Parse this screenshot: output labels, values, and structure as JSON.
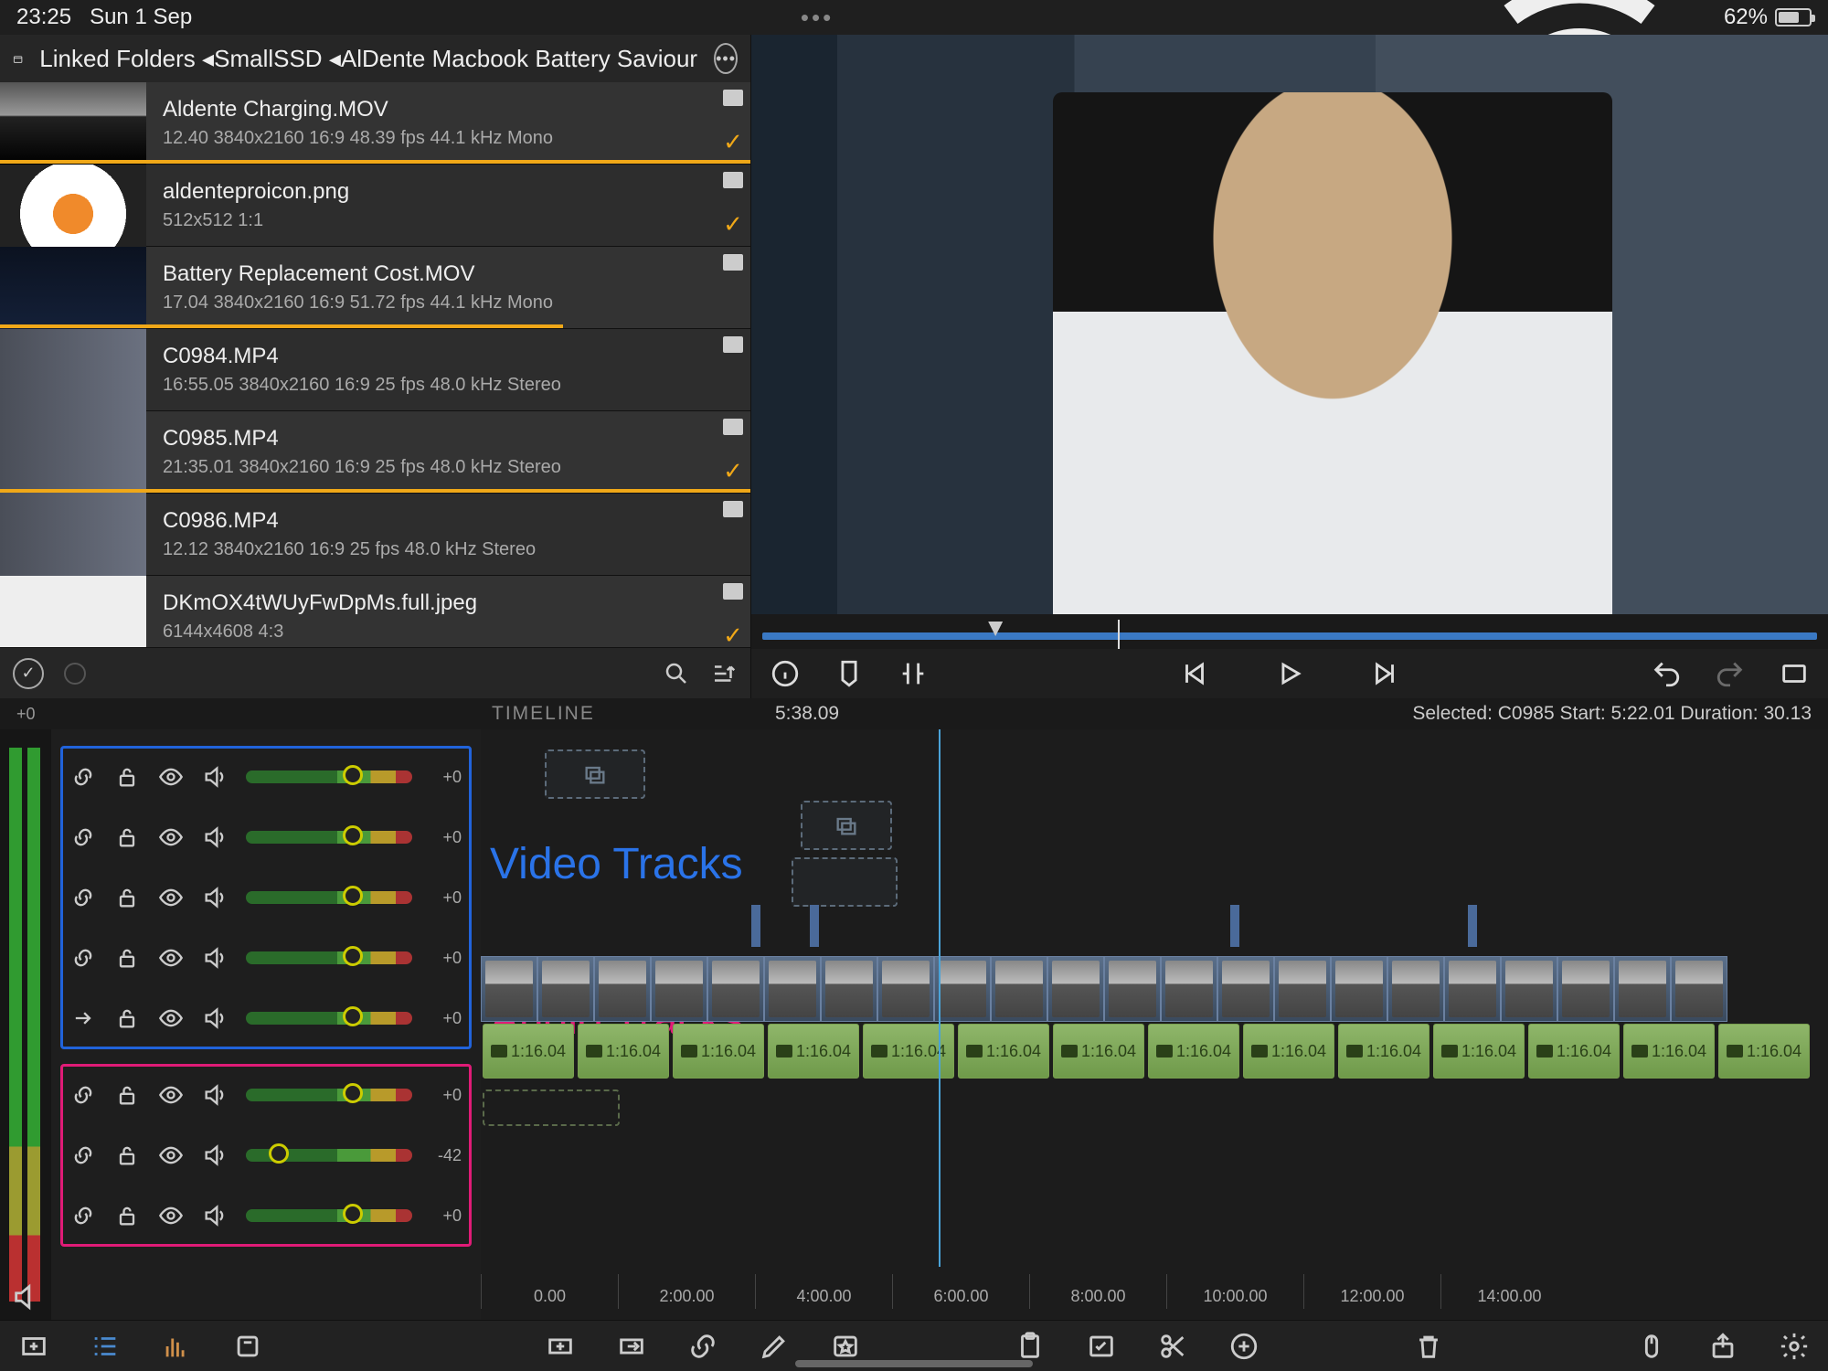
{
  "status": {
    "time": "23:25",
    "date": "Sun 1 Sep",
    "battery_pct": "62%"
  },
  "browser": {
    "breadcrumb_root": "Linked Folders",
    "breadcrumb_mid": "SmallSSD",
    "breadcrumb_leaf": "AlDente Macbook Battery Saviour",
    "items": [
      {
        "title": "Aldente Charging.MOV",
        "meta": "12.40  3840x2160  16:9  48.39 fps  44.1 kHz  Mono",
        "imported": true,
        "bar": 100,
        "thumb": "bw"
      },
      {
        "title": "aldenteproicon.png",
        "meta": "512x512  1:1",
        "imported": true,
        "bar": 0,
        "thumb": "food"
      },
      {
        "title": "Battery Replacement Cost.MOV",
        "meta": "17.04  3840x2160  16:9  51.72 fps  44.1 kHz  Mono",
        "imported": false,
        "bar": 75,
        "thumb": "dark"
      },
      {
        "title": "C0984.MP4",
        "meta": "16:55.05  3840x2160  16:9  25 fps  48.0 kHz  Stereo",
        "imported": false,
        "bar": 0,
        "thumb": "person"
      },
      {
        "title": "C0985.MP4",
        "meta": "21:35.01  3840x2160  16:9  25 fps  48.0 kHz  Stereo",
        "imported": true,
        "bar": 100,
        "thumb": "person"
      },
      {
        "title": "C0986.MP4",
        "meta": "12.12  3840x2160  16:9  25 fps  48.0 kHz  Stereo",
        "imported": false,
        "bar": 0,
        "thumb": "person"
      },
      {
        "title": "DKmOX4tWUyFwDpMs.full.jpeg",
        "meta": "6144x4608  4:3",
        "imported": true,
        "bar": 0,
        "thumb": "white"
      }
    ]
  },
  "timeline": {
    "label": "TIMELINE",
    "header_left": "+0",
    "playhead_time": "5:38.09",
    "selection": "Selected: C0985 Start: 5:22.01 Duration: 30.13",
    "video_label": "Video Tracks",
    "audio_label": "Audio Tracks",
    "video_tracks": [
      {
        "db": "+0",
        "knob": 58
      },
      {
        "db": "+0",
        "knob": 58
      },
      {
        "db": "+0",
        "knob": 58
      },
      {
        "db": "+0",
        "knob": 58
      },
      {
        "db": "+0",
        "knob": 58
      }
    ],
    "audio_tracks": [
      {
        "db": "+0",
        "knob": 58
      },
      {
        "db": "-42",
        "knob": 14
      },
      {
        "db": "+0",
        "knob": 58
      }
    ],
    "audio_clip_label": "1:16.04",
    "ruler": [
      "0.00",
      "2:00.00",
      "4:00.00",
      "6:00.00",
      "8:00.00",
      "10:00.00",
      "12:00.00",
      "14:00.00"
    ]
  }
}
